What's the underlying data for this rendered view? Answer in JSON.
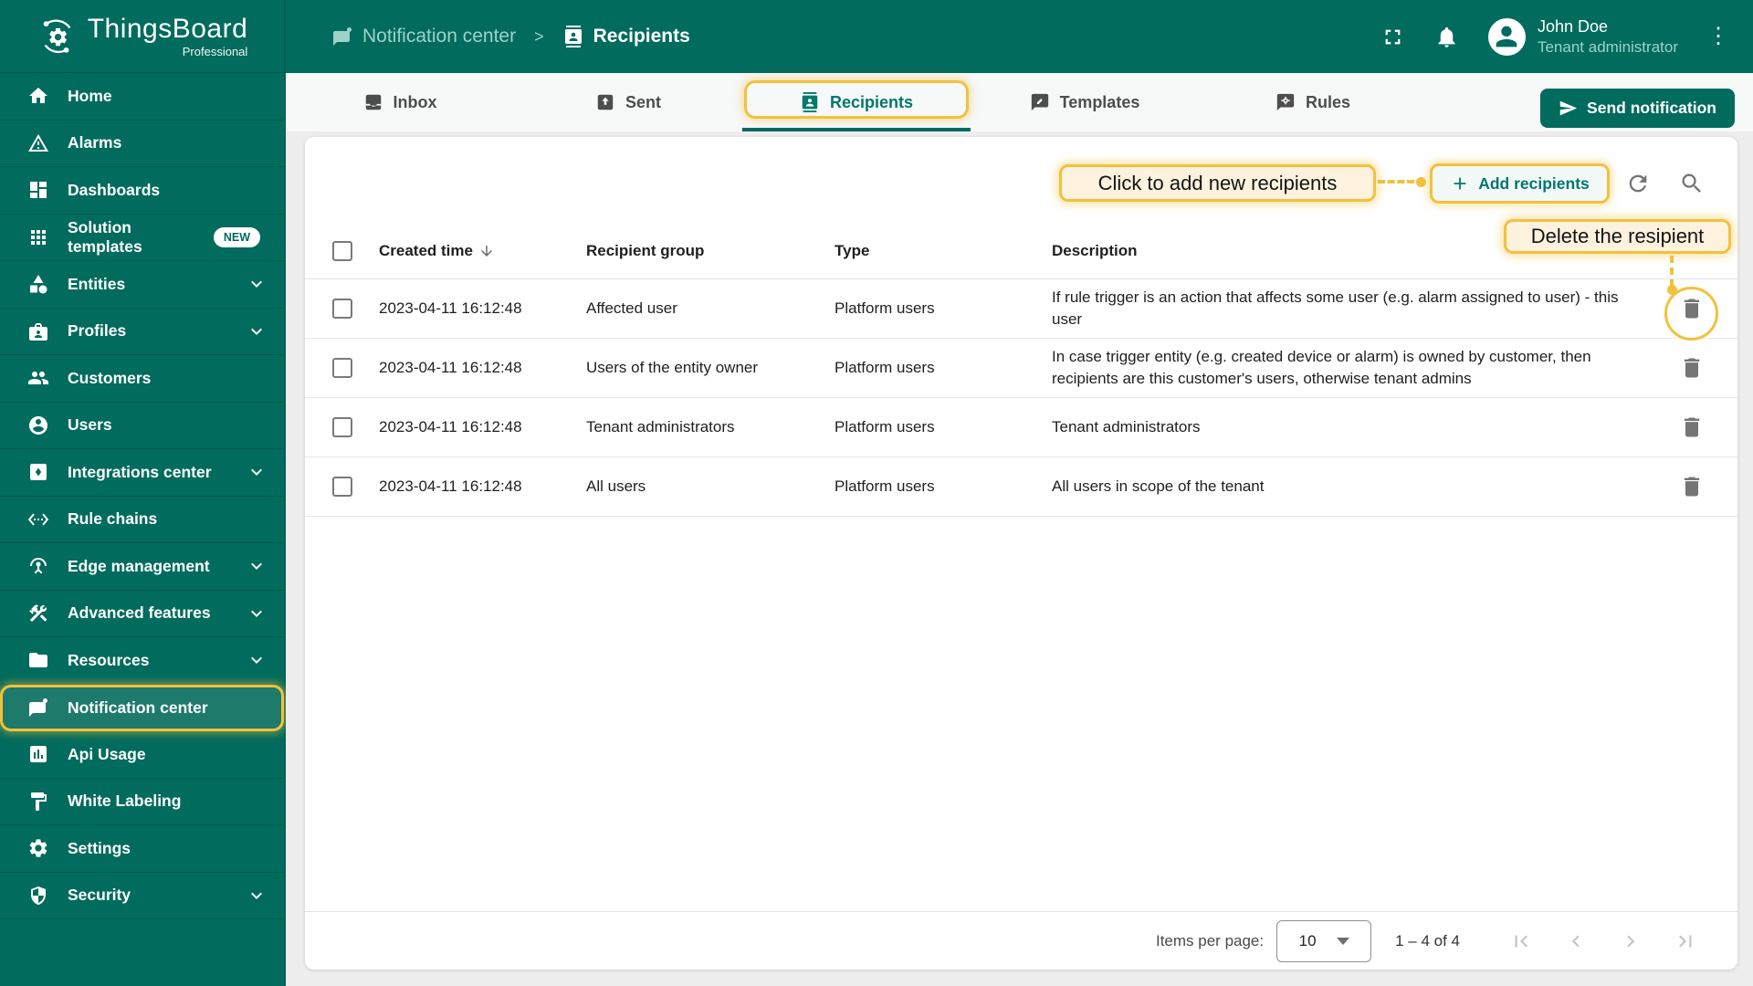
{
  "brand": {
    "name": "ThingsBoard",
    "edition": "Professional"
  },
  "topbar": {
    "breadcrumb": {
      "parent": "Notification center",
      "separator": ">",
      "current": "Recipients"
    },
    "user": {
      "name": "John Doe",
      "role": "Tenant administrator"
    }
  },
  "sidebar": {
    "items": [
      {
        "label": "Home",
        "icon": "home-icon"
      },
      {
        "label": "Alarms",
        "icon": "alarms-icon"
      },
      {
        "label": "Dashboards",
        "icon": "dashboards-icon"
      },
      {
        "label": "Solution templates",
        "icon": "solution-templates-icon",
        "badge": "NEW"
      },
      {
        "label": "Entities",
        "icon": "entities-icon",
        "expandable": true
      },
      {
        "label": "Profiles",
        "icon": "profiles-icon",
        "expandable": true
      },
      {
        "label": "Customers",
        "icon": "customers-icon"
      },
      {
        "label": "Users",
        "icon": "users-icon"
      },
      {
        "label": "Integrations center",
        "icon": "integrations-icon",
        "expandable": true
      },
      {
        "label": "Rule chains",
        "icon": "rule-chains-icon"
      },
      {
        "label": "Edge management",
        "icon": "edge-management-icon",
        "expandable": true
      },
      {
        "label": "Advanced features",
        "icon": "advanced-features-icon",
        "expandable": true
      },
      {
        "label": "Resources",
        "icon": "resources-icon",
        "expandable": true
      },
      {
        "label": "Notification center",
        "icon": "notification-center-icon",
        "active": true
      },
      {
        "label": "Api Usage",
        "icon": "api-usage-icon"
      },
      {
        "label": "White Labeling",
        "icon": "white-labeling-icon"
      },
      {
        "label": "Settings",
        "icon": "settings-icon"
      },
      {
        "label": "Security",
        "icon": "security-icon",
        "expandable": true
      }
    ]
  },
  "tabs": [
    {
      "label": "Inbox",
      "icon": "inbox-icon"
    },
    {
      "label": "Sent",
      "icon": "sent-icon"
    },
    {
      "label": "Recipients",
      "icon": "recipients-icon",
      "active": true,
      "highlighted": true
    },
    {
      "label": "Templates",
      "icon": "templates-icon"
    },
    {
      "label": "Rules",
      "icon": "rules-icon"
    }
  ],
  "actions": {
    "send_notification": "Send notification",
    "add_recipients": "Add recipients"
  },
  "callouts": {
    "add_recipients": "Click to add new recipients",
    "delete_recipient": "Delete the resipient"
  },
  "table": {
    "columns": [
      "Created time",
      "Recipient group",
      "Type",
      "Description"
    ],
    "sort_column": "Created time",
    "sort_direction": "desc",
    "rows": [
      {
        "created_time": "2023-04-11 16:12:48",
        "recipient_group": "Affected user",
        "type": "Platform users",
        "description": "If rule trigger is an action that affects some user (e.g. alarm assigned to user) - this user"
      },
      {
        "created_time": "2023-04-11 16:12:48",
        "recipient_group": "Users of the entity owner",
        "type": "Platform users",
        "description": "In case trigger entity (e.g. created device or alarm) is owned by customer, then recipients are this customer's users, otherwise tenant admins"
      },
      {
        "created_time": "2023-04-11 16:12:48",
        "recipient_group": "Tenant administrators",
        "type": "Platform users",
        "description": "Tenant administrators"
      },
      {
        "created_time": "2023-04-11 16:12:48",
        "recipient_group": "All users",
        "type": "Platform users",
        "description": "All users in scope of the tenant"
      }
    ]
  },
  "pagination": {
    "items_per_page_label": "Items per page:",
    "items_per_page": "10",
    "range": "1 – 4 of 4"
  },
  "colors": {
    "primary_green": "#016B5D",
    "accent_teal": "#00786B",
    "highlight_yellow": "#F2C13D",
    "callout_bg": "#FCF2DE",
    "page_bg": "#EDEDED"
  }
}
